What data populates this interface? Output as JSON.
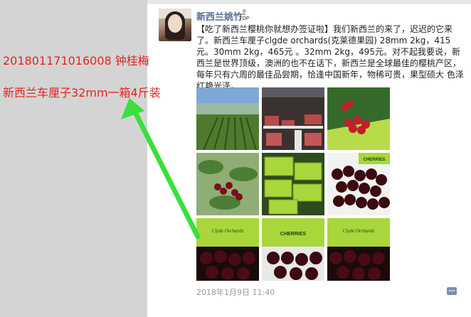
{
  "annotation": {
    "line1": "201801171016008    钟桂梅",
    "line2": "新西兰车厘子32mm一箱4斤装",
    "color": "#e8231f",
    "arrow_color": "#39e03a"
  },
  "post": {
    "author": "新西兰姚竹",
    "badge": "TOP",
    "text": "【吃了新西兰樱桃你就想办签证啦】我们新西兰的来了，迟迟的它来了。新西兰车厘子clgde orchards(克莱德果园) 28mm  2kg，415元。30mm 2kg，465元 。32mm 2kg，495元。对不起我要说，新西兰是世界顶级，澳洲的也不在话下，新西兰是全球最佳的樱桃产区，每年只有六周的最佳品尝期，恰逢中国新年，物稀可贵，果型硕大 色泽红艳光泽。",
    "timestamp": "2018年1月9日 11:40",
    "author_color": "#566b95"
  },
  "photos": [
    {
      "name": "vineyard-photo",
      "kind": "orchard"
    },
    {
      "name": "packing-line-photo",
      "kind": "factory"
    },
    {
      "name": "cherry-box-photo",
      "kind": "box-cherries"
    },
    {
      "name": "cherry-tree-photo",
      "kind": "tree"
    },
    {
      "name": "green-boxes-photo",
      "kind": "boxes"
    },
    {
      "name": "cherries-box-label-photo",
      "kind": "cherries-label"
    },
    {
      "name": "clyde-orchards-box-photo-1",
      "kind": "clyde-1",
      "label": "Clyde Orchards"
    },
    {
      "name": "clyde-orchards-box-photo-2",
      "kind": "clyde-2",
      "label": "CHERRIES"
    },
    {
      "name": "clyde-orchards-box-photo-3",
      "kind": "clyde-3",
      "label": "Clyde Orchards"
    }
  ]
}
